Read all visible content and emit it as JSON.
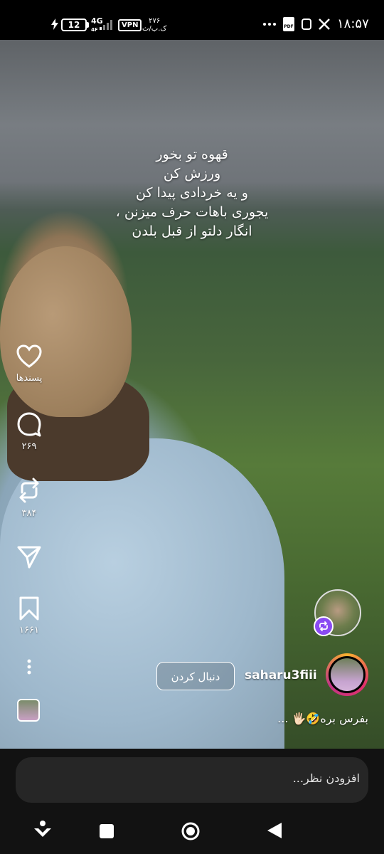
{
  "status_bar": {
    "time": "۱۸:۵۷",
    "battery": "12",
    "network": "4G",
    "network_sub": "4F",
    "vpn": "VPN",
    "speed_value": "۲۷۶",
    "speed_unit": "ک.ب/ث"
  },
  "post": {
    "overlay_text": [
      "قهوه تو بخور",
      "ورزش کن",
      "و یه خردادی پیدا کن",
      "یجوری باهات حرف میزنن ،",
      "انگار دلتو از قبل بلدن"
    ],
    "username": "saharu3fiii",
    "follow_label": "دنبال کردن",
    "caption": "بفرس بره🤣🖐🏻 ..."
  },
  "actions": {
    "likes_label": "پسندها",
    "comments_count": "۲۶۹",
    "reposts_count": "۳۸۴",
    "saves_count": "۱۶۶۱"
  },
  "comment_bar": {
    "placeholder": "افزودن نظر..."
  },
  "icons": [
    "heart-icon",
    "comment-icon",
    "repost-icon",
    "send-icon",
    "bookmark-icon",
    "more-icon",
    "back-icon",
    "home-icon",
    "recents-icon",
    "menu-icon",
    "x-icon",
    "pdf-icon",
    "dots-icon"
  ]
}
